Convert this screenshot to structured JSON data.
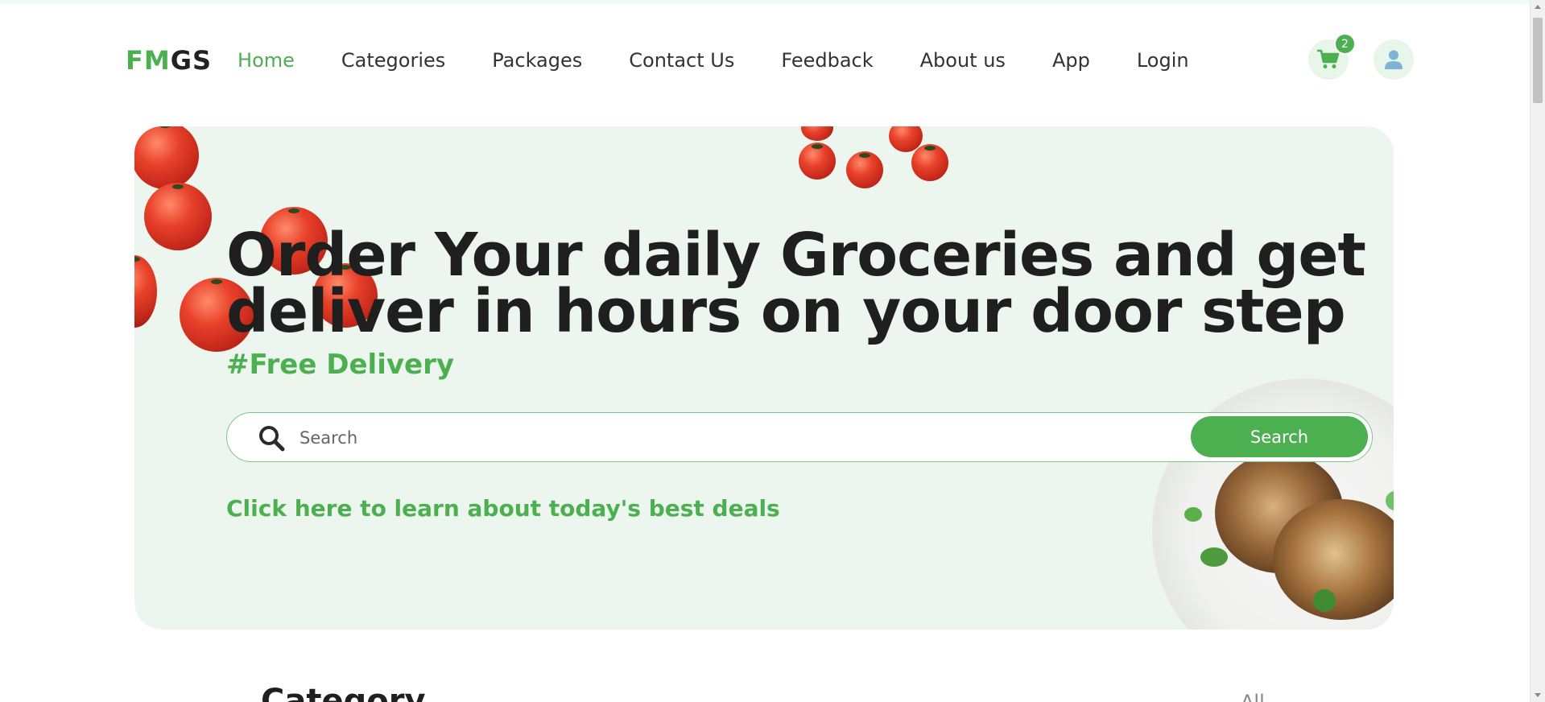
{
  "brand": {
    "logo_part1": "FM",
    "logo_part2": "GS"
  },
  "nav": {
    "items": [
      {
        "label": "Home",
        "active": true
      },
      {
        "label": "Categories",
        "active": false
      },
      {
        "label": "Packages",
        "active": false
      },
      {
        "label": "Contact Us",
        "active": false
      },
      {
        "label": "Feedback",
        "active": false
      },
      {
        "label": "About us",
        "active": false
      },
      {
        "label": "App",
        "active": false
      },
      {
        "label": "Login",
        "active": false
      }
    ],
    "cart_icon": "cart-icon",
    "cart_count": "2",
    "user_icon": "user-icon"
  },
  "hero": {
    "headline": "Order Your daily Groceries and get deliver in hours on your door step",
    "tagline": "#Free Delivery",
    "search": {
      "placeholder": "Search",
      "value": "",
      "button_label": "Search",
      "icon": "search-icon"
    },
    "deals_link": "Click here to learn about today's best deals"
  },
  "category": {
    "title": "Category",
    "all_label": "All"
  },
  "colors": {
    "accent": "#4caf50",
    "hero_bg": "#ecf6ee",
    "badge_bg": "#4caf50",
    "icon_bg": "#e8f5e9",
    "user_icon": "#7fb3d5"
  }
}
